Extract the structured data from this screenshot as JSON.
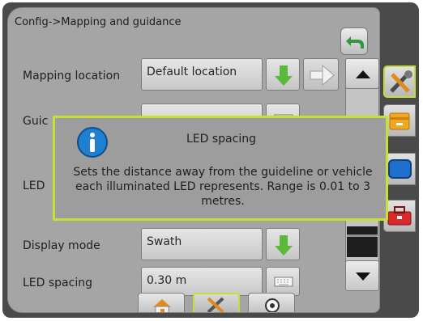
{
  "header": {
    "title": "Config->Mapping and guidance"
  },
  "rows": [
    {
      "label": "Mapping location",
      "value": "Default location"
    },
    {
      "label": "Guic",
      "value": ""
    },
    {
      "label": "LED",
      "value": ""
    },
    {
      "label": "Display mode",
      "value": "Swath"
    },
    {
      "label": "LED spacing",
      "value": "0.30 m"
    }
  ],
  "popup": {
    "title": "LED spacing",
    "body": "Sets the distance away from the guideline or vehicle each illuminated LED represents. Range is 0.01 to 3 metres."
  },
  "side_tabs": [
    "wrench-screwdriver-icon",
    "folder-icon",
    "display-icon",
    "toolbox-icon"
  ],
  "bottom_tabs": [
    "home-icon",
    "tools-icon",
    "gps-icon"
  ],
  "colors": {
    "accent_border": "#c7e033",
    "arrow_green": "#5bb83a",
    "info_blue": "#1f7fd0",
    "device_frame": "#4a4a4a"
  }
}
